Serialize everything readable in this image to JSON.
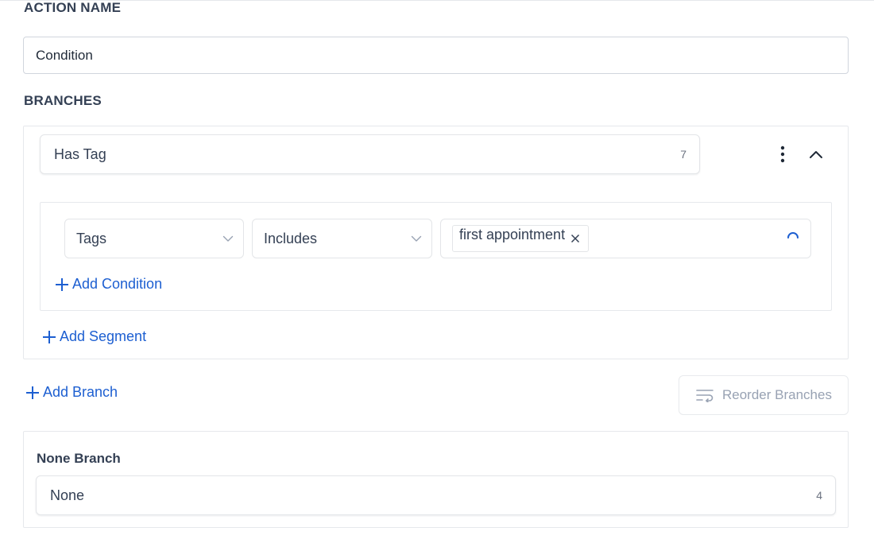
{
  "action": {
    "label": "ACTION NAME",
    "value": "Condition"
  },
  "branches": {
    "label": "BRANCHES",
    "items": [
      {
        "name": "Has Tag",
        "char_count": "7",
        "conditions": [
          {
            "field": "Tags",
            "operator": "Includes",
            "tags": [
              "first appointment"
            ]
          }
        ],
        "add_condition_label": "Add Condition",
        "add_segment_label": "Add Segment"
      }
    ],
    "add_branch_label": "Add Branch",
    "reorder_label": "Reorder Branches"
  },
  "none_branch": {
    "label": "None Branch",
    "value": "None",
    "char_count": "4"
  },
  "colors": {
    "link": "#1d5fd1",
    "muted": "#98a2b3",
    "border": "#d0d5dd"
  }
}
